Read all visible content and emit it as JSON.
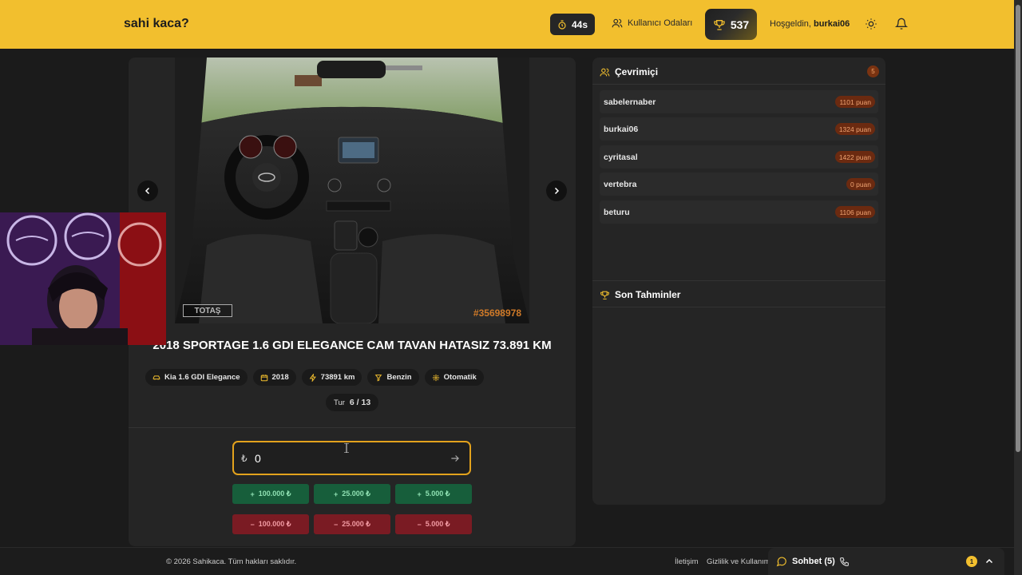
{
  "header": {
    "brand": "sahi kaca?",
    "timer": "44s",
    "rooms_label": "Kullanıcı Odaları",
    "score": "537",
    "welcome_prefix": "Hoşgeldin,",
    "username": "burkai06",
    "icons": [
      "stopwatch-icon",
      "users-icon",
      "trophy-icon",
      "sun-icon",
      "bell-icon"
    ],
    "accent_color": "#f2bf2e"
  },
  "listing": {
    "photo_id": "#35698978",
    "photo_logo": "TOTAŞ",
    "title": "2018 SPORTAGE 1.6 GDI ELEGANCE CAM TAVAN HATASIZ 73.891 KM",
    "chips": [
      {
        "icon": "car-icon",
        "label": "Kia 1.6 GDI Elegance"
      },
      {
        "icon": "calendar-icon",
        "label": "2018"
      },
      {
        "icon": "speed-icon",
        "label": "73891 km"
      },
      {
        "icon": "fuel-icon",
        "label": "Benzin"
      },
      {
        "icon": "gear-icon",
        "label": "Otomatik"
      }
    ],
    "round_label": "Tur",
    "round_value": "6 / 13"
  },
  "guess": {
    "currency": "₺",
    "value": "0",
    "increase_buttons": [
      "100.000 ₺",
      "25.000 ₺",
      "5.000 ₺"
    ],
    "decrease_buttons": [
      "100.000 ₺",
      "25.000 ₺",
      "5.000 ₺"
    ],
    "increase_color": "#175e3b",
    "decrease_color": "#7a1b23"
  },
  "online": {
    "title": "Çevrimiçi",
    "count": "5",
    "users": [
      {
        "name": "sabelernaber",
        "points": "1101 puan"
      },
      {
        "name": "burkai06",
        "points": "1324 puan"
      },
      {
        "name": "cyritasal",
        "points": "1422 puan"
      },
      {
        "name": "vertebra",
        "points": "0 puan"
      },
      {
        "name": "beturu",
        "points": "1106 puan"
      }
    ]
  },
  "recent": {
    "title": "Son Tahminler"
  },
  "footer": {
    "copyright": "© 2026 Sahikaca. Tüm hakları saklıdır.",
    "contact": "İletişim",
    "privacy": "Gizlilik ve Kullanım",
    "chat_label": "Sohbet (5)",
    "chat_badge": "1"
  }
}
